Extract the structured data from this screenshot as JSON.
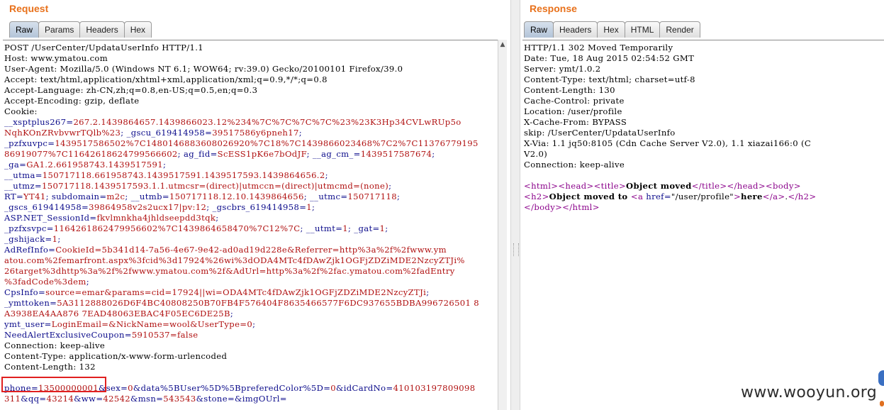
{
  "request": {
    "title": "Request",
    "tabs": [
      "Raw",
      "Params",
      "Headers",
      "Hex"
    ],
    "headers": [
      "POST /UserCenter/UpdataUserInfo HTTP/1.1",
      "Host: www.ymatou.com",
      "User-Agent: Mozilla/5.0 (Windows NT 6.1; WOW64; rv:39.0) Gecko/20100101 Firefox/39.0",
      "Accept: text/html,application/xhtml+xml,application/xml;q=0.9,*/*;q=0.8",
      "Accept-Language: zh-CN,zh;q=0.8,en-US;q=0.5,en;q=0.3",
      "Accept-Encoding: gzip, deflate",
      "Cookie:"
    ],
    "cookies": [
      {
        "lines": [
          [
            [
              "k",
              "__xsptplus267="
            ],
            [
              "v",
              "267.2.1439864657.1439866023.12%234%7C%7C%7C%7C%23%23K3Hp34CVLwRUp5o"
            ]
          ],
          [
            [
              "v",
              "NqhKOnZRvbvwrTQlb%23"
            ],
            [
              "k",
              "; _gscu_619414958="
            ],
            [
              "v",
              "39517586y6pneh17"
            ],
            [
              "k",
              ";"
            ]
          ]
        ]
      },
      {
        "lines": [
          [
            [
              "k",
              "_pzfxuvpc="
            ],
            [
              "v",
              "1439517586502%7C1480146883608026920%7C18%7C1439866023468%7C2%7C11376779195"
            ]
          ],
          [
            [
              "v",
              "86919077%7C11642618624799566602"
            ],
            [
              "k",
              "; ag_fid="
            ],
            [
              "v",
              "ScESS1pK6e7bOdJF"
            ],
            [
              "k",
              "; __ag_cm_="
            ],
            [
              "v",
              "1439517587674"
            ],
            [
              "k",
              ";"
            ]
          ]
        ]
      },
      {
        "lines": [
          [
            [
              "k",
              "_ga="
            ],
            [
              "v",
              "GA1.2.661958743.1439517591"
            ],
            [
              "k",
              ";"
            ]
          ]
        ]
      },
      {
        "lines": [
          [
            [
              "k",
              "__utma="
            ],
            [
              "v",
              "150717118.661958743.1439517591.1439517593.1439864656.2"
            ],
            [
              "k",
              ";"
            ]
          ]
        ]
      },
      {
        "lines": [
          [
            [
              "k",
              "__utmz="
            ],
            [
              "v",
              "150717118.1439517593.1.1.utmcsr=(direct)|utmccn=(direct)|utmcmd=(none)"
            ],
            [
              "k",
              ";"
            ]
          ]
        ]
      },
      {
        "lines": [
          [
            [
              "k",
              "RT="
            ],
            [
              "v",
              "YT41"
            ],
            [
              "k",
              "; subdomain="
            ],
            [
              "v",
              "m2c"
            ],
            [
              "k",
              "; __utmb="
            ],
            [
              "v",
              "150717118.12.10.1439864656"
            ],
            [
              "k",
              "; __utmc="
            ],
            [
              "v",
              "150717118"
            ],
            [
              "k",
              ";"
            ]
          ]
        ]
      },
      {
        "lines": [
          [
            [
              "k",
              "_gscs_619414958="
            ],
            [
              "v",
              "39864958v2s2ucx17|pv:12"
            ],
            [
              "k",
              "; _gscbrs_619414958="
            ],
            [
              "v",
              "1"
            ],
            [
              "k",
              ";"
            ]
          ]
        ]
      },
      {
        "lines": [
          [
            [
              "k",
              "ASP.NET_SessionId="
            ],
            [
              "v",
              "fkvlmnkha4jhldseepdd3tqk"
            ],
            [
              "k",
              ";"
            ]
          ]
        ]
      },
      {
        "lines": [
          [
            [
              "k",
              "_pzfxsvpc="
            ],
            [
              "v",
              "1164261862479956602%7C1439864658470%7C12%7C"
            ],
            [
              "k",
              "; __utmt="
            ],
            [
              "v",
              "1"
            ],
            [
              "k",
              "; _gat="
            ],
            [
              "v",
              "1"
            ],
            [
              "k",
              ";"
            ]
          ]
        ]
      },
      {
        "lines": [
          [
            [
              "k",
              "_gshijack="
            ],
            [
              "v",
              "1"
            ],
            [
              "k",
              ";"
            ]
          ]
        ]
      },
      {
        "lines": [
          [
            [
              "k",
              "AdRefInfo="
            ],
            [
              "v",
              "CookieId=5b341d14-7a56-4e67-9e42-ad0ad19d228e&Referrer=http%3a%2f%2fwww.ym"
            ]
          ],
          [
            [
              "v",
              "atou.com%2femarfront.aspx%3fcid%3d17924%26wi%3dODA4MTc4fDAwZjk1OGFjZDZiMDE2NzcyZTJi%"
            ]
          ],
          [
            [
              "v",
              "26target%3dhttp%3a%2f%2fwww.ymatou.com%2f&AdUrl=http%3a%2f%2fac.ymatou.com%2fadEntry"
            ]
          ],
          [
            [
              "v",
              "%3fadCode%3dem"
            ],
            [
              "k",
              ";"
            ]
          ]
        ]
      },
      {
        "lines": [
          [
            [
              "k",
              "CpsInfo="
            ],
            [
              "v",
              "source=emar&params=cid=17924||wi=ODA4MTc4fDAwZjk1OGFjZDZiMDE2NzcyZTJi"
            ],
            [
              "k",
              ";"
            ]
          ]
        ]
      },
      {
        "lines": [
          [
            [
              "k",
              "_ymttoken="
            ],
            [
              "v",
              "5A3112888026D6F4BC40808250B70FB4F576404F8635466577F6DC937655BDBA996726501 8"
            ]
          ],
          [
            [
              "v",
              "A3938EA4AA876 7EAD48063EBAC4F05EC6DE25B"
            ],
            [
              "k",
              ";"
            ]
          ]
        ]
      },
      {
        "lines": [
          [
            [
              "k",
              "ymt_user="
            ],
            [
              "v",
              "LoginEmail=&NickName=wool&UserType=0"
            ],
            [
              "k",
              ";"
            ]
          ]
        ]
      },
      {
        "lines": [
          [
            [
              "k",
              "NeedAlertExclusiveCoupon="
            ],
            [
              "v",
              "5910537=false"
            ]
          ]
        ]
      }
    ],
    "trailer": [
      "Connection: keep-alive",
      "Content-Type: application/x-www-form-urlencoded",
      "Content-Length: 132"
    ],
    "body": [
      [
        [
          "k",
          "phone="
        ],
        [
          "v",
          "13500000001"
        ],
        [
          "k",
          "&"
        ],
        [
          "k",
          "sex="
        ],
        [
          "v",
          "0"
        ],
        [
          "k",
          "&"
        ],
        [
          "k",
          "data%5BUser%5D%5BpreferedColor%5D="
        ],
        [
          "v",
          "0"
        ],
        [
          "k",
          "&"
        ],
        [
          "k",
          "idCardNo="
        ],
        [
          "v",
          "410103197809098"
        ]
      ],
      [
        [
          "v",
          "311"
        ],
        [
          "k",
          "&"
        ],
        [
          "k",
          "qq="
        ],
        [
          "v",
          "43214"
        ],
        [
          "k",
          "&"
        ],
        [
          "k",
          "ww="
        ],
        [
          "v",
          "42542"
        ],
        [
          "k",
          "&"
        ],
        [
          "k",
          "msn="
        ],
        [
          "v",
          "543543"
        ],
        [
          "k",
          "&"
        ],
        [
          "k",
          "stone="
        ],
        [
          "k",
          "&"
        ],
        [
          "k",
          "imgOUrl="
        ]
      ]
    ]
  },
  "response": {
    "title": "Response",
    "tabs": [
      "Raw",
      "Headers",
      "Hex",
      "HTML",
      "Render"
    ],
    "headers": [
      "HTTP/1.1 302 Moved Temporarily",
      "Date: Tue, 18 Aug 2015 02:54:52 GMT",
      "Server: ymt/1.0.2",
      "Content-Type: text/html; charset=utf-8",
      "Content-Length: 130",
      "Cache-Control: private",
      "Location: /user/profile",
      "X-Cache-From: BYPASS",
      "skip: /UserCenter/UpdataUserInfo",
      "X-Via: 1.1 jq50:8105 (Cdn Cache Server V2.0), 1.1 xiazai166:0 (C",
      "V2.0)",
      "Connection: keep-alive"
    ],
    "html": [
      [
        [
          "t",
          "<html>"
        ],
        [
          "t",
          "<head>"
        ],
        [
          "t",
          "<title>"
        ],
        [
          "b",
          "Object moved"
        ],
        [
          "t",
          "</title>"
        ],
        [
          "t",
          "</head>"
        ],
        [
          "t",
          "<body>"
        ]
      ],
      [
        [
          "t",
          "<h2>"
        ],
        [
          "b",
          "Object moved to "
        ],
        [
          "t",
          "<a "
        ],
        [
          "k",
          "href="
        ],
        [
          "x",
          "\"/user/profile\""
        ],
        [
          "t",
          ">"
        ],
        [
          "b",
          "here"
        ],
        [
          "t",
          "</a>"
        ],
        [
          "n",
          "."
        ],
        [
          "t",
          "</h2>"
        ]
      ],
      [
        [
          "t",
          "</body>"
        ],
        [
          "t",
          "</html>"
        ]
      ]
    ]
  },
  "watermark": "www.wooyun.org",
  "colors": {
    "title": "#e8711b",
    "key": "#0a0a8a",
    "value": "#b01010",
    "tag": "#8a008a",
    "highlight": "#e02020"
  }
}
